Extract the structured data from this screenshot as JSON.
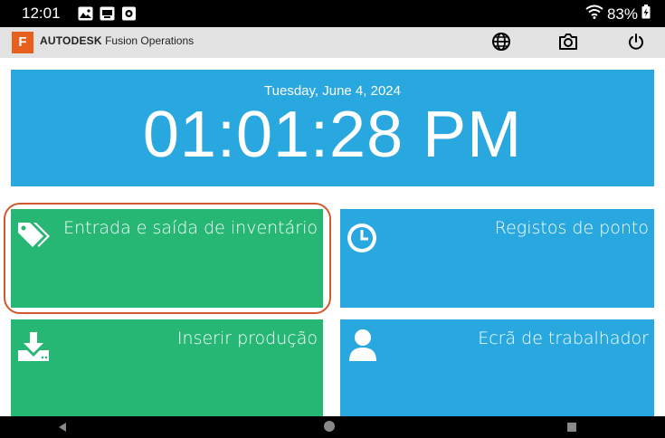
{
  "status_bar": {
    "time": "12:01",
    "battery": "83%",
    "icons": [
      "image-icon",
      "cast-icon",
      "sd-icon",
      "wifi-icon",
      "battery-charging-icon"
    ]
  },
  "header": {
    "logo_letter": "F",
    "brand_strong": "AUTODESK",
    "brand_product": "Fusion Operations",
    "buttons": [
      "globe-icon",
      "camera-icon",
      "power-icon"
    ],
    "background": "#e3e3e3",
    "logo_color": "#e8601d"
  },
  "clock": {
    "date": "Tuesday, June 4, 2024",
    "time": "01:01:28 PM",
    "color": "#29a8e0"
  },
  "tiles": [
    {
      "label": "Entrada e saída de inventário",
      "icon": "tags-icon",
      "color": "#27b775",
      "highlighted": true
    },
    {
      "label": "Registos de ponto",
      "icon": "clock-icon",
      "color": "#29a8e0"
    },
    {
      "label": "Inserir produção",
      "icon": "download-icon",
      "color": "#27b775"
    },
    {
      "label": "Ecrã de trabalhador",
      "icon": "user-icon",
      "color": "#29a8e0"
    }
  ],
  "highlight_color": "#d2582d",
  "nav_bar": {
    "buttons": [
      "back-icon",
      "home-icon",
      "recents-icon"
    ]
  }
}
